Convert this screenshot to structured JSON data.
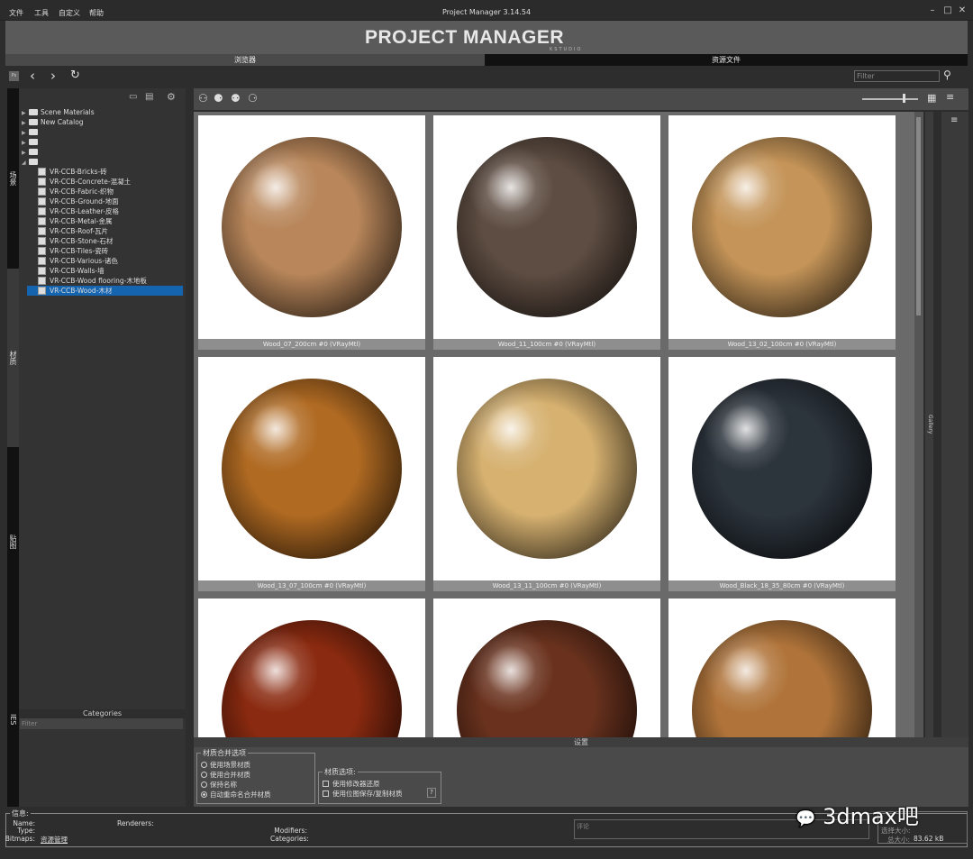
{
  "window": {
    "title": "Project Manager 3.14.54",
    "menu": [
      "文件",
      "工具",
      "自定义",
      "帮助"
    ]
  },
  "banner": {
    "logo": "PROJECT MANAGER",
    "logo_sub": "KSTUDIO"
  },
  "tabs": [
    {
      "label": "浏览器",
      "active": true
    },
    {
      "label": "资源文件",
      "active": false
    }
  ],
  "toolbar": {
    "filter_placeholder": "Filter",
    "ps_label": "Ps"
  },
  "side_tabs": [
    "场景",
    "材质",
    "贴图",
    "IES"
  ],
  "tree": {
    "roots": [
      "Scene Materials",
      "New Catalog"
    ],
    "children": [
      "VR-CCB-Bricks-砖",
      "VR-CCB-Concrete-混凝土",
      "VR-CCB-Fabric-织物",
      "VR-CCB-Ground-地面",
      "VR-CCB-Leather-皮格",
      "VR-CCB-Metal-金属",
      "VR-CCB-Roof-瓦片",
      "VR-CCB-Stone-石材",
      "VR-CCB-Tiles-瓷砖",
      "VR-CCB-Various-诸色",
      "VR-CCB-Walls-墙",
      "VR-CCB-Wood flooring-木地板",
      "VR-CCB-Wood-木材"
    ],
    "selected": "VR-CCB-Wood-木材"
  },
  "categories": {
    "title": "Categories",
    "filter_placeholder": "Filter"
  },
  "materials": [
    {
      "name": "Wood_07_200cm #0 (VRayMtl)",
      "color": "#b8865a"
    },
    {
      "name": "Wood_11_100cm #0 (VRayMtl)",
      "color": "#5e4d42"
    },
    {
      "name": "Wood_13_02_100cm #0 (VRayMtl)",
      "color": "#c49458"
    },
    {
      "name": "Wood_13_07_100cm #0 (VRayMtl)",
      "color": "#b06a22"
    },
    {
      "name": "Wood_13_11_100cm #0 (VRayMtl)",
      "color": "#d6b170"
    },
    {
      "name": "Wood_Black_18_35_80cm #0 (VRayMtl)",
      "color": "#2c343c"
    },
    {
      "name": "",
      "color": "#8a2a10"
    },
    {
      "name": "",
      "color": "#6a321e"
    },
    {
      "name": "",
      "color": "#b0743a"
    }
  ],
  "gallery_label": "Gallery",
  "settings": {
    "title": "设置",
    "merge": {
      "title": "材质合并选项",
      "options": [
        "使用场景材质",
        "使用合并材质",
        "保持名称",
        "自动重命名合并材质"
      ],
      "selected": 3
    },
    "material": {
      "title": "材质选项:",
      "checks": [
        "使用修改器还原",
        "使用位图保存/复制材质"
      ],
      "help": "?"
    }
  },
  "info": {
    "title": "信息:",
    "name_label": "Name:",
    "type_label": "Type:",
    "bitmaps_label": "Bitmaps:",
    "bitmaps_value": "资源管理",
    "renderers_label": "Renderers:",
    "modifiers_label": "Modifiers:",
    "categories_label": "Categories:",
    "comment_placeholder": "评论",
    "selected_size_label": "选择大小:",
    "total_size_label": "总大小:",
    "total_size_value": "83.62 kB"
  },
  "watermark": "3dmax吧"
}
